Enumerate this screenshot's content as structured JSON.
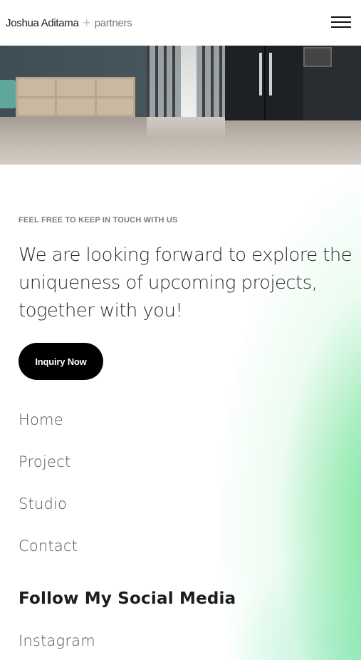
{
  "header": {
    "logo_name": "Joshua Aditama",
    "logo_separator": "+",
    "logo_suffix": "partners",
    "menu_icon": "hamburger-menu-icon"
  },
  "hero": {
    "image": "office-interior-photo"
  },
  "contact": {
    "eyebrow": "FEEL FREE TO KEEP IN TOUCH WITH US",
    "headline": "We are looking forward to explore the uniqueness of upcoming projects, together with you!",
    "cta_label": "Inquiry Now"
  },
  "nav": {
    "items": [
      {
        "label": "Home"
      },
      {
        "label": "Project"
      },
      {
        "label": "Studio"
      },
      {
        "label": "Contact"
      }
    ]
  },
  "social": {
    "title": "Follow My Social Media",
    "links": [
      {
        "label": "Instagram"
      }
    ]
  },
  "colors": {
    "accent_gradient": "#6fe39a",
    "button_bg": "#000000",
    "button_text": "#ffffff"
  }
}
